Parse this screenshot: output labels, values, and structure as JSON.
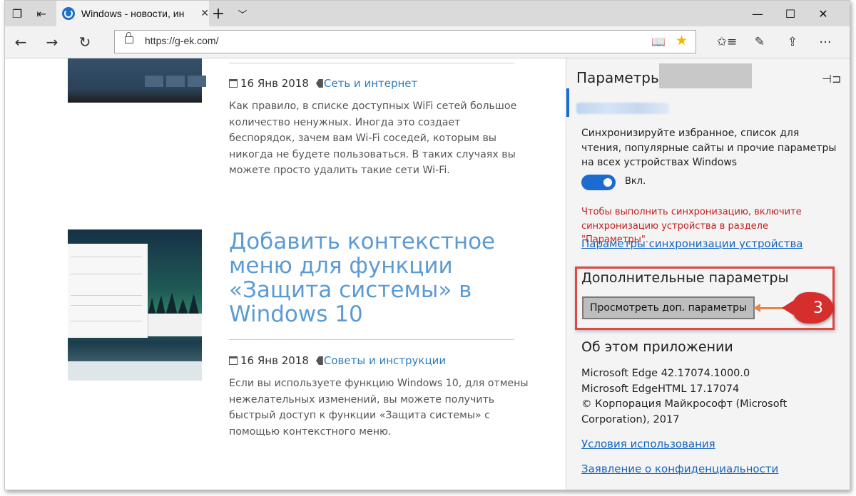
{
  "tab": {
    "title": "Windows - новости, ин"
  },
  "address_bar": {
    "url": "https://g-ek.com/"
  },
  "articles": [
    {
      "date": "16 Янв 2018",
      "category": "Сеть и интернет",
      "excerpt": "Как правило, в списке доступных WiFi сетей большое количество ненужных. Иногда это создает беспорядок, зачем вам Wi-Fi соседей, которым вы никогда не будете пользоваться. В таких случаях вы можете просто удалить такие сети Wi-Fi."
    },
    {
      "title": "Добавить контекстное меню для функции «Защита системы» в Windows 10",
      "date": "16 Янв 2018",
      "category": "Советы и инструкции",
      "excerpt": "Если вы используете функцию Windows 10, для отмены нежелательных изменений, вы можете получить быстрый доступ к функции «Защита системы» с помощью контекстного меню."
    }
  ],
  "settings": {
    "title": "Параметры",
    "sync_description": "Синхронизируйте избранное, список для чтения, популярные сайты и прочие параметры на всех устройствах Windows",
    "toggle_label": "Вкл.",
    "toggle_on": true,
    "warning": "Чтобы выполнить синхронизацию, включите синхронизацию устройства в разделе \"Параметры\".",
    "sync_link": "Параметры синхронизации устройства",
    "advanced_heading": "Дополнительные параметры",
    "advanced_button": "Просмотреть доп. параметры",
    "callout_number": "3",
    "about_heading": "Об этом приложении",
    "about_lines": [
      "Microsoft Edge 42.17074.1000.0",
      "Microsoft EdgeHTML 17.17074",
      "© Корпорация Майкрософт (Microsoft Corporation), 2017"
    ],
    "terms_link": "Условия использования",
    "privacy_link": "Заявление о конфиденциальности"
  },
  "colors": {
    "accent": "#1c6bd1",
    "warning": "#c22020",
    "link": "#1565c0",
    "headline": "#5b9bd5",
    "callout": "#d62d2d"
  }
}
